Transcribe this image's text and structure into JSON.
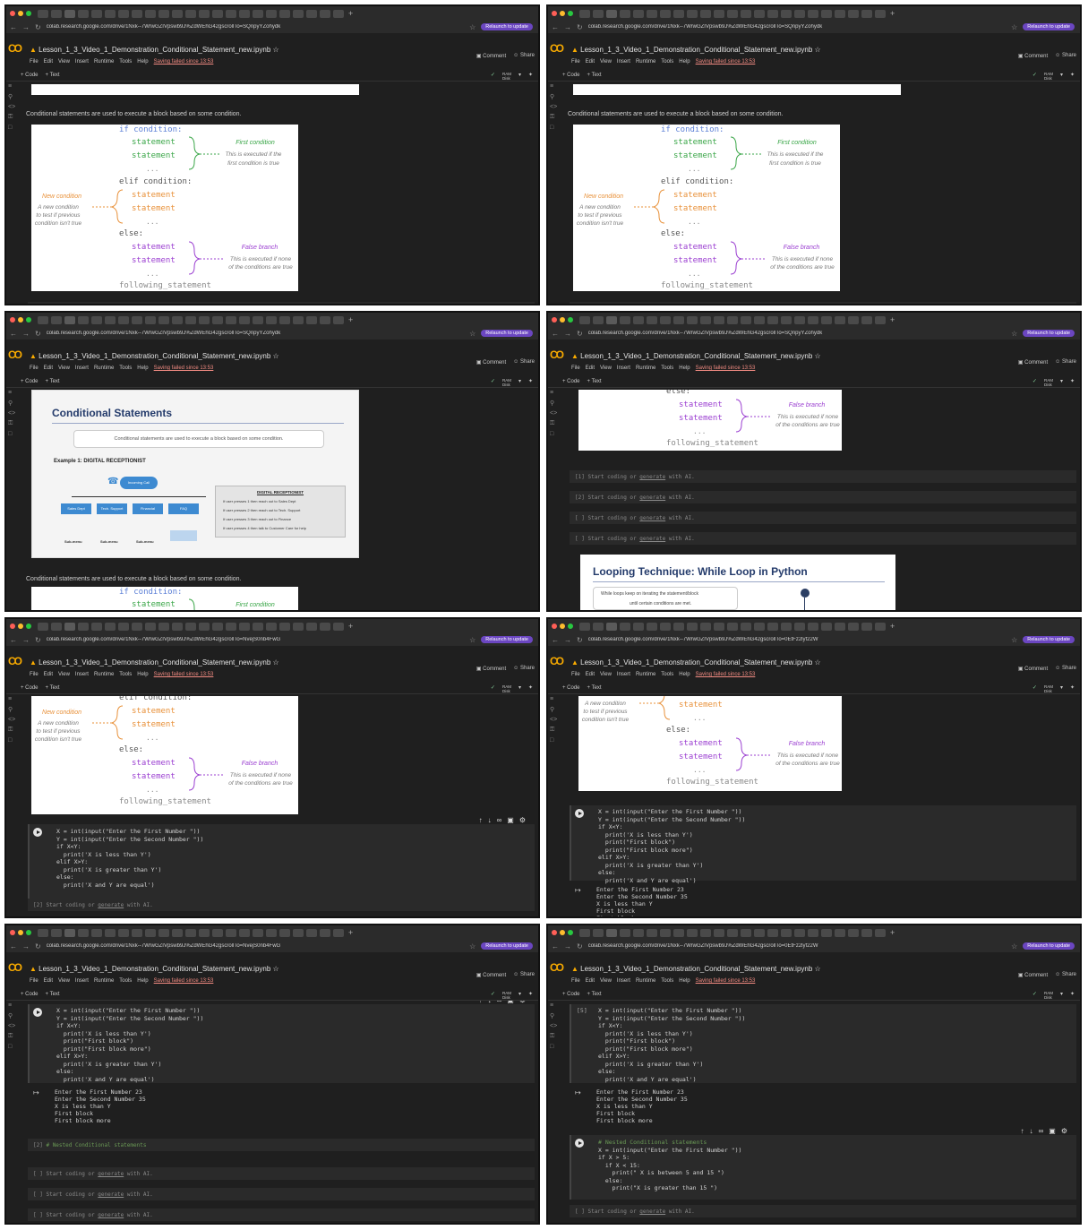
{
  "browser": {
    "url_a": "colab.research.google.com/drive/1Nxk--7WrwGZIVpswb9J%ZdWEhG42gscrollTo=SQnpyYZohydk",
    "url_b": "colab.research.google.com/drive/1Nxk--7WrwGZIVpswb9J%ZdWEhG42gscrollTo=NvejS0nb4FwG",
    "url_c": "colab.research.google.com/drive/1Nxk--7WrwGZIVpswb9J%ZdWEhG42gscrollTo=0EtFz2lyf22W",
    "relaunch": "Relaunch to update"
  },
  "notebook": {
    "title": "Lesson_1_3_Video_1_Demonstration_Conditional_Statement_new.ipynb",
    "menu": [
      "File",
      "Edit",
      "View",
      "Insert",
      "Runtime",
      "Tools",
      "Help"
    ],
    "saving": "Saving failed since 13:53",
    "comment": "Comment",
    "share": "Share",
    "code_btn": "+ Code",
    "text_btn": "+ Text",
    "ram": "RAM",
    "disk": "Disk"
  },
  "text": {
    "intro": "Conditional statements are used to execute a block based on some condition.",
    "empty_cell": "Start coding or",
    "generate": "generate",
    "with_ai": "with AI.",
    "nested_comment": "# Nested Conditional statements"
  },
  "diagram": {
    "if": "if condition:",
    "statement": "statement",
    "dots": "...",
    "elif": "elif condition:",
    "else": "else:",
    "following": "following_statement",
    "first_condition": "First condition",
    "first_desc_1": "This is executed if the",
    "first_desc_2": "first condition is true",
    "new_condition": "New condition",
    "new_desc_1": "A new condition",
    "new_desc_2": "to test if previous",
    "new_desc_3": "condition isn't true",
    "false_branch": "False branch",
    "false_desc_1": "This is executed if none",
    "false_desc_2": "of the conditions are true"
  },
  "slide": {
    "title": "Conditional Statements",
    "subtitle": "Conditional statements are used to execute a block based on some condition.",
    "example": "Example 1: DIGITAL RECEPTIONIST",
    "incoming": "Incoming Call",
    "boxes": [
      "Sales Dept",
      "Tech. Support",
      "Financial",
      "FAQ"
    ],
    "submenu": "Sub-menu",
    "panel_title": "DIGITAL RECEPTIONIST",
    "panel_items": [
      "If user presses 1 then reach out to Sales Dept",
      "If user presses 2 then reach out to Tech. Support",
      "If user presses 3 then reach out to Finance",
      "If user presses 4 then talk to Customer Care for help"
    ]
  },
  "slide2": {
    "title": "Looping Technique: While Loop in Python",
    "desc_1": "While loops keep on iterating the statement/block",
    "desc_2": "until certain conditions are met.",
    "note": "If condition is false"
  },
  "code": {
    "l1": "X = int(input(\"Enter the First Number \"))",
    "l2": "Y = int(input(\"Enter the Second Number \"))",
    "l3": "if X<Y:",
    "l4": "  print('X is less than Y')",
    "l4b": "  print(\"First block\")",
    "l4c": "  print(\"First block more\")",
    "l5": "elif X>Y:",
    "l6": "  print('X is greater than Y')",
    "l7": "else:",
    "l8": "  print('X and Y are equal')"
  },
  "output": {
    "o1": "Enter the First Number 23",
    "o2": "Enter the Second Number 35",
    "o3": "X is less than Y",
    "o4": "First block",
    "o5": "First block more"
  },
  "nested": {
    "n1": "# Nested Conditional statements",
    "n2": "X = int(input(\"Enter the First Number \"))",
    "n3": "if X > 5:",
    "n4": "  if X < 15:",
    "n5": "    print(\" X is between 5 and 15 \")",
    "n6": "  else:",
    "n7": "    print(\"X is greater than 15 \")"
  },
  "exec": {
    "e1": "[1]",
    "e2": "[2]",
    "e5": "[5]",
    "blank": "[ ]"
  },
  "colors": {
    "condition": "#5b7fd6",
    "statement": "#3aa648",
    "new_condition": "#e8913a",
    "false_branch": "#9b3fd1",
    "following": "#888888",
    "keyword": "#555555"
  }
}
